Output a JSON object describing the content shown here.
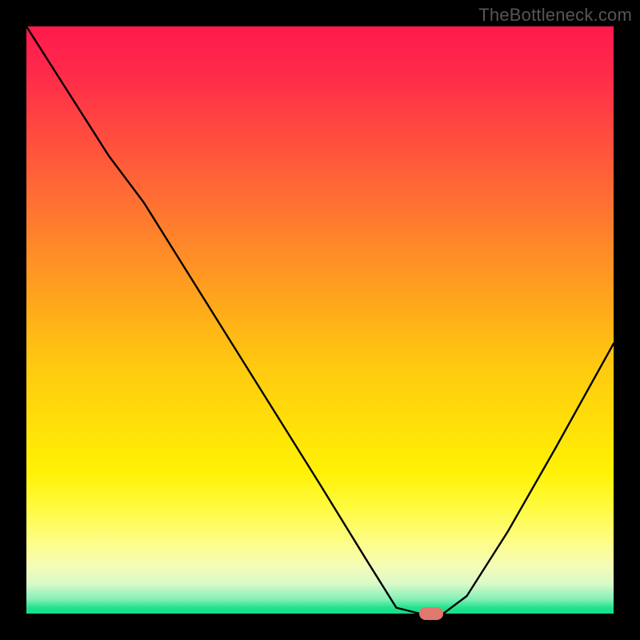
{
  "watermark": "TheBottleneck.com",
  "chart_data": {
    "type": "line",
    "title": "",
    "xlabel": "",
    "ylabel": "",
    "xlim": [
      0,
      100
    ],
    "ylim": [
      0,
      100
    ],
    "series": [
      {
        "name": "curve",
        "x": [
          0,
          14,
          20,
          30,
          40,
          50,
          58,
          63,
          67,
          71,
          75,
          82,
          90,
          100
        ],
        "values": [
          100,
          78,
          70,
          54,
          38,
          22,
          9,
          1,
          0,
          0,
          3,
          14,
          28,
          46
        ]
      }
    ],
    "marker": {
      "x": 69,
      "y": 0,
      "color": "#e0786f"
    },
    "background": "heat-gradient",
    "grid": false,
    "legend": false
  },
  "colors": {
    "stroke": "#000000",
    "page_bg": "#000000"
  }
}
